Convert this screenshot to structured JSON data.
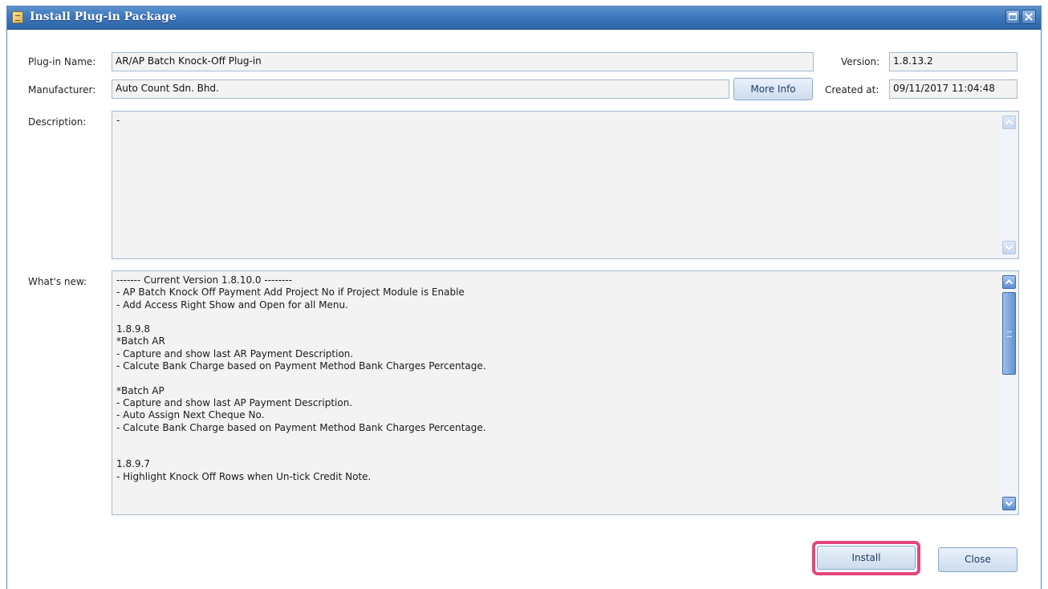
{
  "window": {
    "title": "Install Plug-in Package"
  },
  "form": {
    "plugin_name_label": "Plug-in Name:",
    "plugin_name_value": "AR/AP Batch Knock-Off Plug-in",
    "manufacturer_label": "Manufacturer:",
    "manufacturer_value": "Auto Count Sdn. Bhd.",
    "more_info_label": "More Info",
    "version_label": "Version:",
    "version_value": "1.8.13.2",
    "created_at_label": "Created at:",
    "created_at_value": "09/11/2017 11:04:48",
    "description_label": "Description:",
    "description_value": "-",
    "whats_new_label": "What's new:",
    "whats_new_value": "------- Current Version 1.8.10.0 --------\n- AP Batch Knock Off Payment Add Project No if Project Module is Enable\n- Add Access Right Show and Open for all Menu.\n\n1.8.9.8\n*Batch AR\n- Capture and show last AR Payment Description.\n- Calcute Bank Charge based on Payment Method Bank Charges Percentage.\n\n*Batch AP\n- Capture and show last AP Payment Description.\n- Auto Assign Next Cheque No.\n- Calcute Bank Charge based on Payment Method Bank Charges Percentage.\n\n\n1.8.9.7\n- Highlight Knock Off Rows when Un-tick Credit Note."
  },
  "buttons": {
    "install_label": "Install",
    "close_label": "Close"
  },
  "colors": {
    "title_bar": "#3e78bd",
    "highlight": "#e2477c",
    "field_bg": "#f3f3f3"
  },
  "icons": {
    "window": "package-icon",
    "maximize": "maximize-icon",
    "close": "close-icon"
  }
}
